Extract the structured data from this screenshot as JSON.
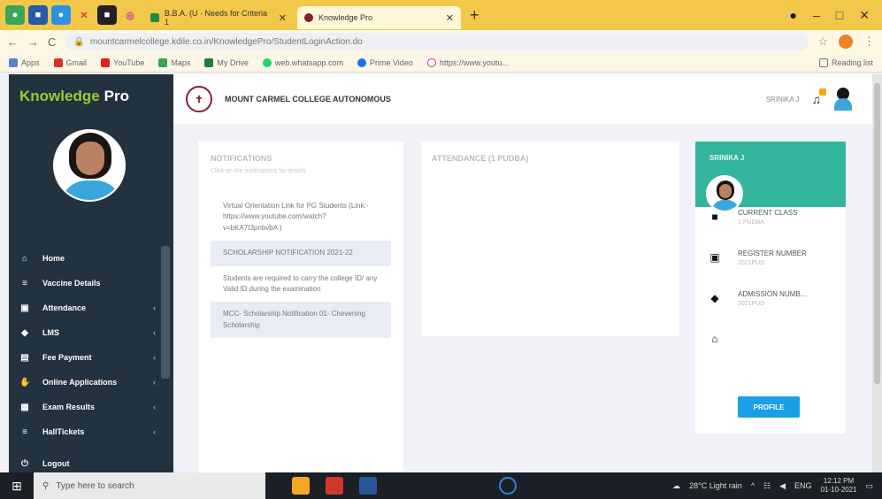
{
  "browser": {
    "tabs": [
      {
        "label": "B.B.A. (U · Needs for Criteria 1",
        "active": false
      },
      {
        "label": "Knowledge Pro",
        "active": true
      }
    ],
    "url": "mountcarmelcollege.kdile.co.in/KnowledgePro/StudentLoginAction.do",
    "bookmarks": [
      "Apps",
      "Gmail",
      "YouTube",
      "Maps",
      "My Drive",
      "web.whatsapp.com",
      "Prime Video",
      "https://www.youtu..."
    ],
    "reading_list": "Reading list"
  },
  "app": {
    "brand_part1": "Knowledge",
    "brand_part2": "Pro",
    "college_name": "MOUNT CARMEL COLLEGE AUTONOMOUS",
    "user_name": "SRINIKA J"
  },
  "nav": [
    {
      "label": "Home",
      "icon": "home-icon",
      "chevron": false
    },
    {
      "label": "Vaccine Details",
      "icon": "list-icon",
      "chevron": false
    },
    {
      "label": "Attendance",
      "icon": "calendar-icon",
      "chevron": true
    },
    {
      "label": "LMS",
      "icon": "graduation-cap-icon",
      "chevron": true
    },
    {
      "label": "Fee Payment",
      "icon": "money-icon",
      "chevron": true
    },
    {
      "label": "Online Applications",
      "icon": "hand-icon",
      "chevron": true
    },
    {
      "label": "Exam Results",
      "icon": "grid-icon",
      "chevron": true
    },
    {
      "label": "HallTickets",
      "icon": "ticket-icon",
      "chevron": true
    }
  ],
  "logout_label": "Logout",
  "notifications": {
    "title": "NOTIFICATIONS",
    "subtitle": "Click on the notifications for details",
    "items": [
      "Virtual Orientation Link for PG Students (Link:- https://www.youtube.com/watch?v=bKA7I3pnbvbA )",
      "SCHOLARSHIP NOTIFICATION 2021-22",
      "Students are required to carry the college ID/ any Valid ID during the examination",
      "MCC- Scholarship Notification 01- Chevening Scholarship"
    ]
  },
  "attendance": {
    "title": "ATTENDANCE (1 PUDBA)"
  },
  "profile": {
    "name": "SRINIKA J",
    "rows": [
      {
        "label": "CURRENT CLASS",
        "value": "1 PUDBA",
        "icon": "book-icon"
      },
      {
        "label": "REGISTER NUMBER",
        "value": "2021PUD",
        "icon": "id-card-icon"
      },
      {
        "label": "ADMISSION NUMB...",
        "value": "2021PUD",
        "icon": "graduation-cap-icon"
      },
      {
        "label": "",
        "value": "",
        "icon": "bank-icon"
      }
    ],
    "button": "PROFILE"
  },
  "taskbar": {
    "search_placeholder": "Type here to search",
    "weather": "28°C Light rain",
    "lang": "ENG",
    "time": "12:12 PM",
    "date": "01-10-2021"
  }
}
